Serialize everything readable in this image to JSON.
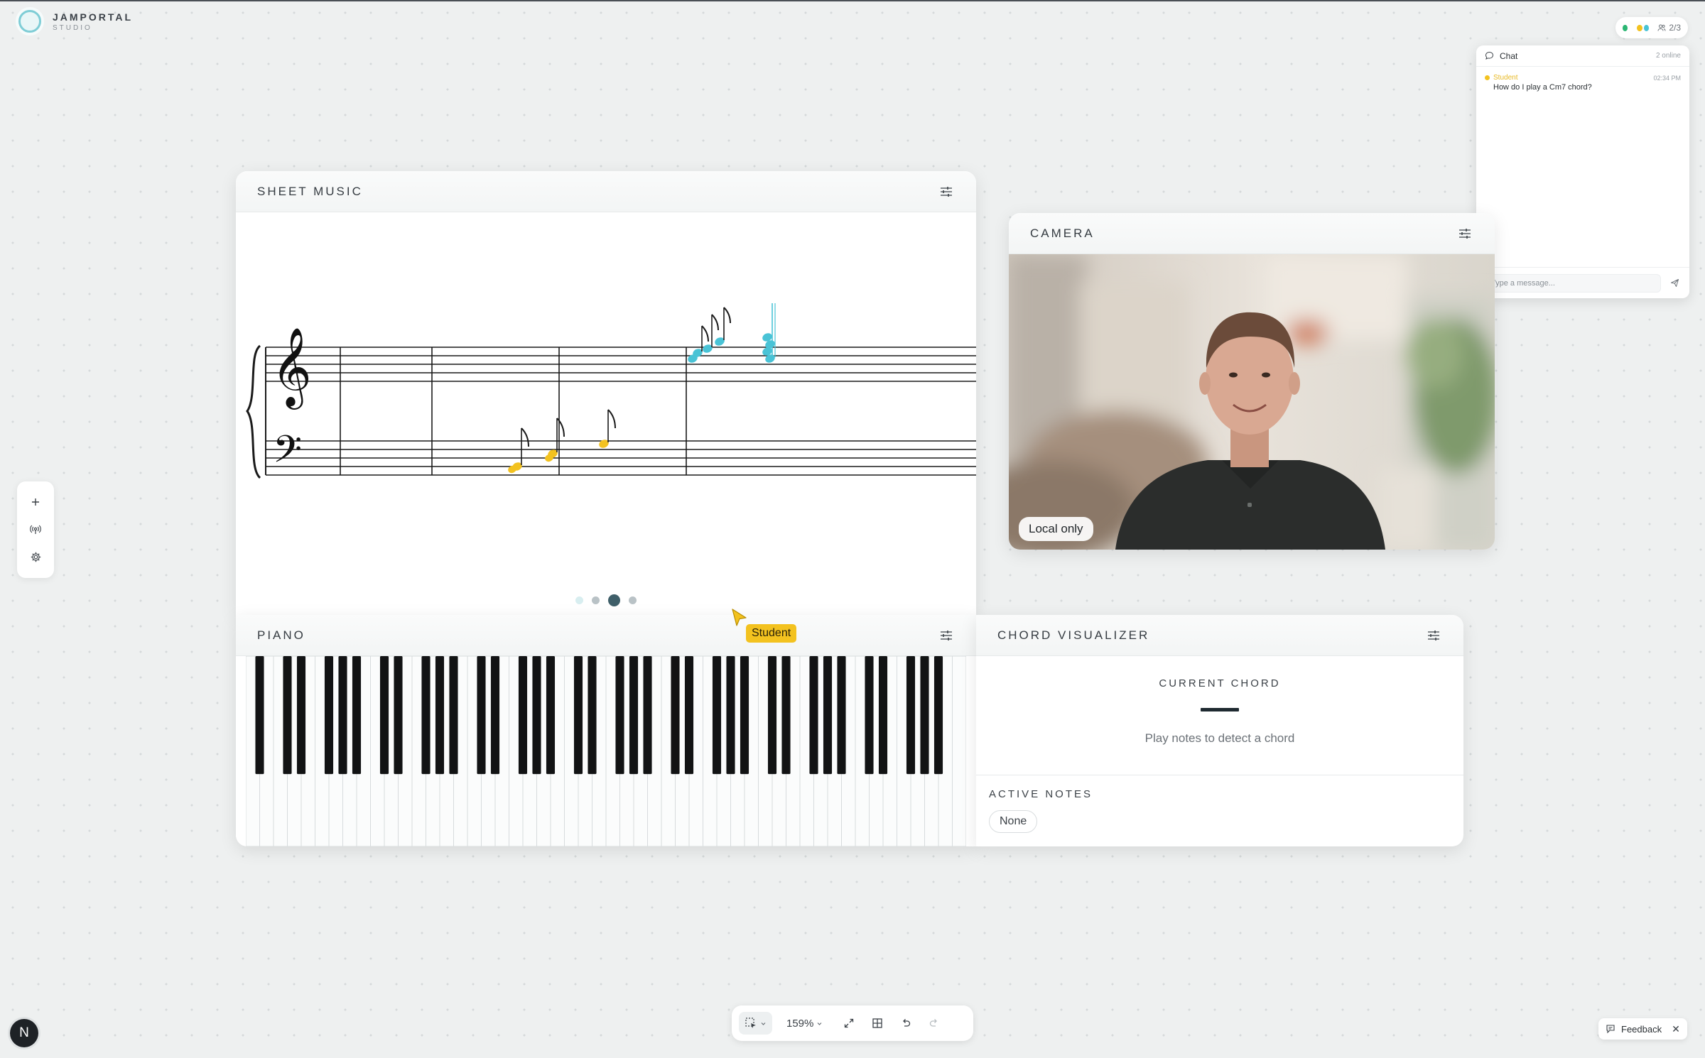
{
  "brand": {
    "name": "JAMPORTAL",
    "sub": "STUDIO"
  },
  "presence": {
    "count": "2/3",
    "colors": [
      "#2bb673",
      "#f3c21f",
      "#49c3d6"
    ]
  },
  "chat": {
    "title": "Chat",
    "online": "2 online",
    "messages": [
      {
        "author": "Student",
        "time": "02:34 PM",
        "text": "How do I play a Cm7 chord?",
        "color": "#f3c21f"
      }
    ],
    "placeholder": "Type a message..."
  },
  "left_tools": [
    "plus-icon",
    "broadcast-icon",
    "gear-icon"
  ],
  "sheet_music": {
    "title": "SHEET MUSIC",
    "page_count": 4,
    "active_page": 3,
    "note_colors": {
      "student": "#f3c21f",
      "teacher": "#49c3d6"
    }
  },
  "camera": {
    "title": "CAMERA",
    "badge": "Local only"
  },
  "piano": {
    "title": "PIANO",
    "white_keys": 52
  },
  "chord": {
    "title": "CHORD VISUALIZER",
    "current_label": "CURRENT CHORD",
    "current_value": "—",
    "hint": "Play notes to detect a chord",
    "active_label": "ACTIVE NOTES",
    "active_value": "None"
  },
  "cursor": {
    "label": "Student",
    "color": "#f3c21f"
  },
  "toolbar": {
    "zoom": "159%"
  },
  "avatar": {
    "initial": "N"
  },
  "feedback": {
    "label": "Feedback"
  }
}
